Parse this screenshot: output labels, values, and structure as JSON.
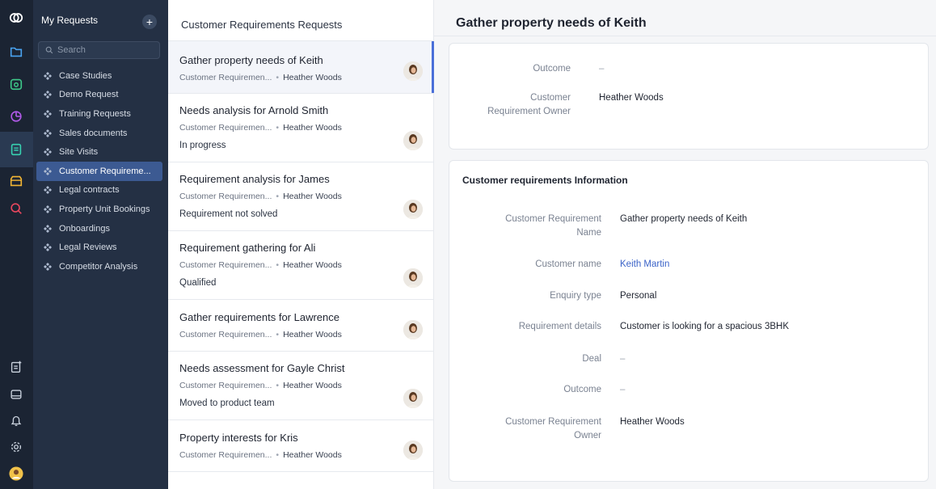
{
  "rail": {
    "icons": [
      "logo-icon",
      "folder-icon",
      "calendar-icon",
      "pie-chart-icon",
      "notes-icon",
      "store-icon",
      "search-analytics-icon",
      "new-entry-icon",
      "board-icon",
      "bell-icon",
      "settings-icon",
      "user-avatar"
    ]
  },
  "nav": {
    "title": "My Requests",
    "add_label": "+",
    "search_placeholder": "Search",
    "items": [
      {
        "label": "Case Studies"
      },
      {
        "label": "Demo Request"
      },
      {
        "label": "Training Requests"
      },
      {
        "label": "Sales documents"
      },
      {
        "label": "Site Visits"
      },
      {
        "label": "Customer Requireme..."
      },
      {
        "label": "Legal contracts"
      },
      {
        "label": "Property Unit Bookings"
      },
      {
        "label": "Onboardings"
      },
      {
        "label": "Legal Reviews"
      },
      {
        "label": "Competitor Analysis"
      }
    ],
    "active_index": 5
  },
  "list": {
    "title": "Customer Requirements Requests",
    "cards": [
      {
        "title": "Gather property needs of Keith",
        "module": "Customer Requiremen...",
        "owner": "Heather Woods",
        "status": ""
      },
      {
        "title": "Needs analysis for Arnold Smith",
        "module": "Customer Requiremen...",
        "owner": "Heather Woods",
        "status": "In progress"
      },
      {
        "title": "Requirement analysis for James",
        "module": "Customer Requiremen...",
        "owner": "Heather Woods",
        "status": "Requirement not solved"
      },
      {
        "title": "Requirement gathering for Ali",
        "module": "Customer Requiremen...",
        "owner": "Heather Woods",
        "status": "Qualified"
      },
      {
        "title": "Gather requirements for Lawrence",
        "module": "Customer Requiremen...",
        "owner": "Heather Woods",
        "status": ""
      },
      {
        "title": "Needs assessment for Gayle Christ",
        "module": "Customer Requiremen...",
        "owner": "Heather Woods",
        "status": "Moved to product team"
      },
      {
        "title": "Property interests for Kris",
        "module": "Customer Requiremen...",
        "owner": "Heather Woods",
        "status": ""
      }
    ],
    "separator": "•"
  },
  "detail": {
    "title": "Gather property needs of Keith",
    "summary": {
      "outcome_label": "Outcome",
      "outcome_value": "–",
      "owner_label_line1": "Customer",
      "owner_label_line2": "Requirement Owner",
      "owner_value": "Heather Woods"
    },
    "info": {
      "section_title": "Customer requirements Information",
      "name_label_line1": "Customer Requirement",
      "name_label_line2": "Name",
      "name_value": "Gather property needs of Keith",
      "customer_label": "Customer name",
      "customer_value": "Keith Martin",
      "enquiry_label": "Enquiry type",
      "enquiry_value": "Personal",
      "details_label": "Requirement details",
      "details_value": "Customer is looking for a spacious 3BHK",
      "deal_label": "Deal",
      "deal_value": "–",
      "outcome_label": "Outcome",
      "outcome_value": "–",
      "owner_label_line1": "Customer Requirement",
      "owner_label_line2": "Owner",
      "owner_value": "Heather Woods"
    }
  },
  "colors": {
    "rail_bg": "#1b2433",
    "nav_bg": "#243044",
    "active_nav": "#3c5a92",
    "accent": "#4a6fd8",
    "link": "#3b63c8"
  }
}
